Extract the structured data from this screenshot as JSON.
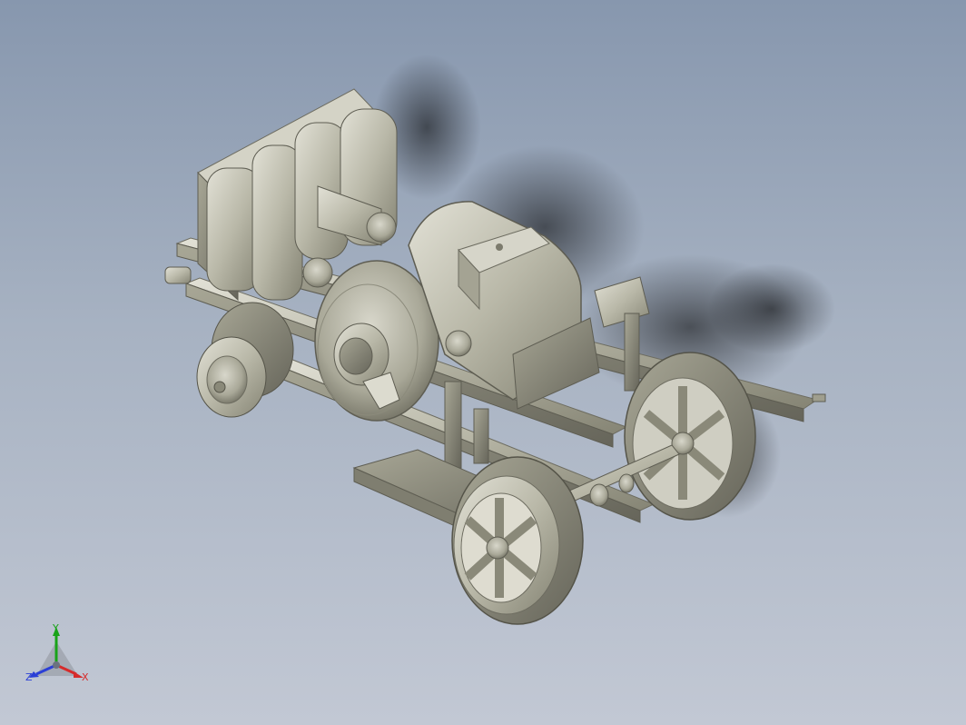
{
  "viewport": {
    "background_top": "#8797ae",
    "background_bottom": "#c2c8d4",
    "model_color": "#bdbcad"
  },
  "triad": {
    "y_label": "Y",
    "z_label": "Z",
    "x_label": "X",
    "y_color": "#19a319",
    "z_color": "#2b3fd6",
    "x_color": "#d62b2b"
  }
}
